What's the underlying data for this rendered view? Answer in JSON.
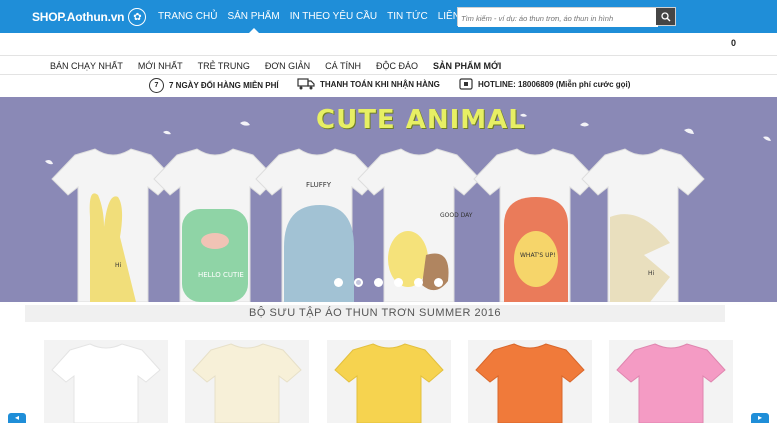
{
  "header": {
    "logo_text": "SHOP.Aothun.vn",
    "nav": [
      "TRANG CHỦ",
      "SẢN PHẨM",
      "IN THEO YÊU CẦU",
      "TIN TỨC",
      "LIÊN HỆ"
    ],
    "active_nav": "SẢN PHẨM",
    "search_placeholder": "Tìm kiếm - ví dụ: áo thun trơn, áo thun in hình",
    "cart_count": "0"
  },
  "categories": [
    "BÁN CHẠY NHẤT",
    "MỚI NHẤT",
    "TRẺ TRUNG",
    "ĐƠN GIẢN",
    "CÁ TÍNH",
    "ĐỘC ĐÁO",
    "SẢN PHẨM MỚI"
  ],
  "info": {
    "return_days": "7",
    "return_text": "7 NGÀY ĐỔI HÀNG MIỄN PHÍ",
    "cod_text": "THANH TOÁN KHI NHẬN HÀNG",
    "hotline_text": "HOTLINE: 18006809 (Miễn phí cước gọi)"
  },
  "banner": {
    "title": "CUTE ANIMAL",
    "shirt_texts": [
      "Hi",
      "HELLO CUTIE",
      "FLUFFY",
      "GOOD DAY",
      "WHAT'S UP!",
      "Hi"
    ],
    "slide_count": 6,
    "active_slide": 2
  },
  "collection": {
    "title": "BỘ SƯU TẬP ÁO THUN TRƠN SUMMER 2016",
    "product_colors": [
      "#ffffff",
      "#f7f0d8",
      "#f6d34f",
      "#f07a3a",
      "#f49bc4"
    ]
  },
  "colors": {
    "brand_blue": "#1f8ed8",
    "banner_bg": "#8a89b6",
    "title_yellow": "#e7ef64"
  }
}
